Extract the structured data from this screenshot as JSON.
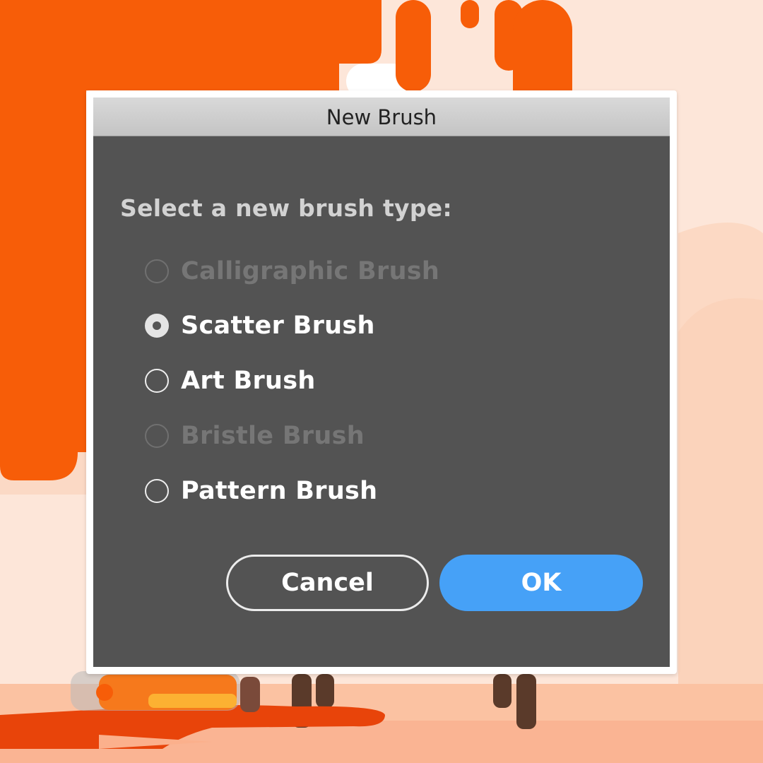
{
  "dialog": {
    "title": "New Brush",
    "prompt": "Select a new brush type:",
    "options": [
      {
        "label": "Calligraphic Brush",
        "selected": false,
        "enabled": false
      },
      {
        "label": "Scatter Brush",
        "selected": true,
        "enabled": true
      },
      {
        "label": "Art Brush",
        "selected": false,
        "enabled": true
      },
      {
        "label": "Bristle Brush",
        "selected": false,
        "enabled": false
      },
      {
        "label": "Pattern Brush",
        "selected": false,
        "enabled": true
      }
    ],
    "buttons": {
      "cancel": "Cancel",
      "ok": "OK"
    }
  },
  "colors": {
    "dialog_bg": "#535353",
    "accent": "#46a1f7",
    "paint_orange": "#f75d08",
    "background_peach": "#fde6d9"
  }
}
